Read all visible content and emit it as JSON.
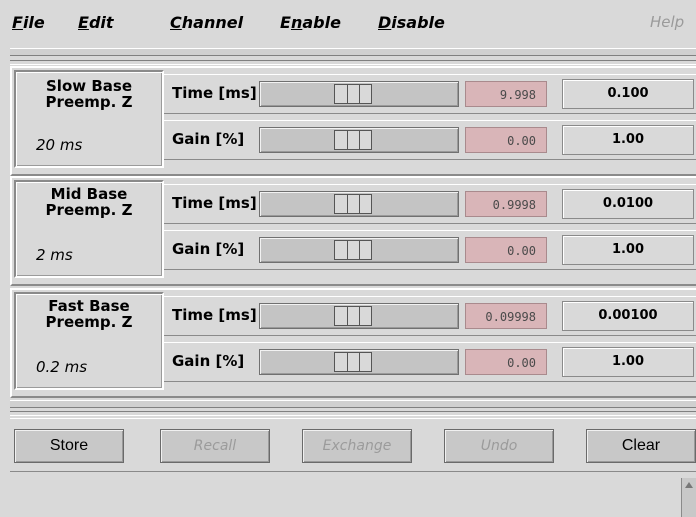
{
  "menu": {
    "file": {
      "u": "F",
      "rest": "ile"
    },
    "edit": {
      "u": "E",
      "rest": "dit"
    },
    "channel": {
      "u": "C",
      "rest": "hannel"
    },
    "enable": {
      "pre": "E",
      "u": "n",
      "rest": "able"
    },
    "disable": {
      "u": "D",
      "rest": "isable"
    },
    "help": "Help"
  },
  "groups": [
    {
      "title": "Slow Base\nPreemp. Z",
      "sub": "20 ms",
      "rows": [
        {
          "label": "Time [ms]",
          "thumb": 0.45,
          "value": "9.998",
          "num": "0.100"
        },
        {
          "label": "Gain [%]",
          "thumb": 0.45,
          "value": "0.00",
          "num": "1.00"
        }
      ]
    },
    {
      "title": "Mid Base\nPreemp. Z",
      "sub": "2 ms",
      "rows": [
        {
          "label": "Time [ms]",
          "thumb": 0.45,
          "value": "0.9998",
          "num": "0.0100"
        },
        {
          "label": "Gain [%]",
          "thumb": 0.45,
          "value": "0.00",
          "num": "1.00"
        }
      ]
    },
    {
      "title": "Fast Base\nPreemp. Z",
      "sub": "0.2 ms",
      "rows": [
        {
          "label": "Time [ms]",
          "thumb": 0.45,
          "value": "0.09998",
          "num": "0.00100"
        },
        {
          "label": "Gain [%]",
          "thumb": 0.45,
          "value": "0.00",
          "num": "1.00"
        }
      ]
    }
  ],
  "buttons": {
    "store": "Store",
    "recall": "Recall",
    "exchange": "Exchange",
    "undo": "Undo",
    "clear": "Clear"
  },
  "colors": {
    "background": "#d9d9d9",
    "value_box": "#d9b5b8",
    "disabled_text": "#9b9b9b"
  }
}
